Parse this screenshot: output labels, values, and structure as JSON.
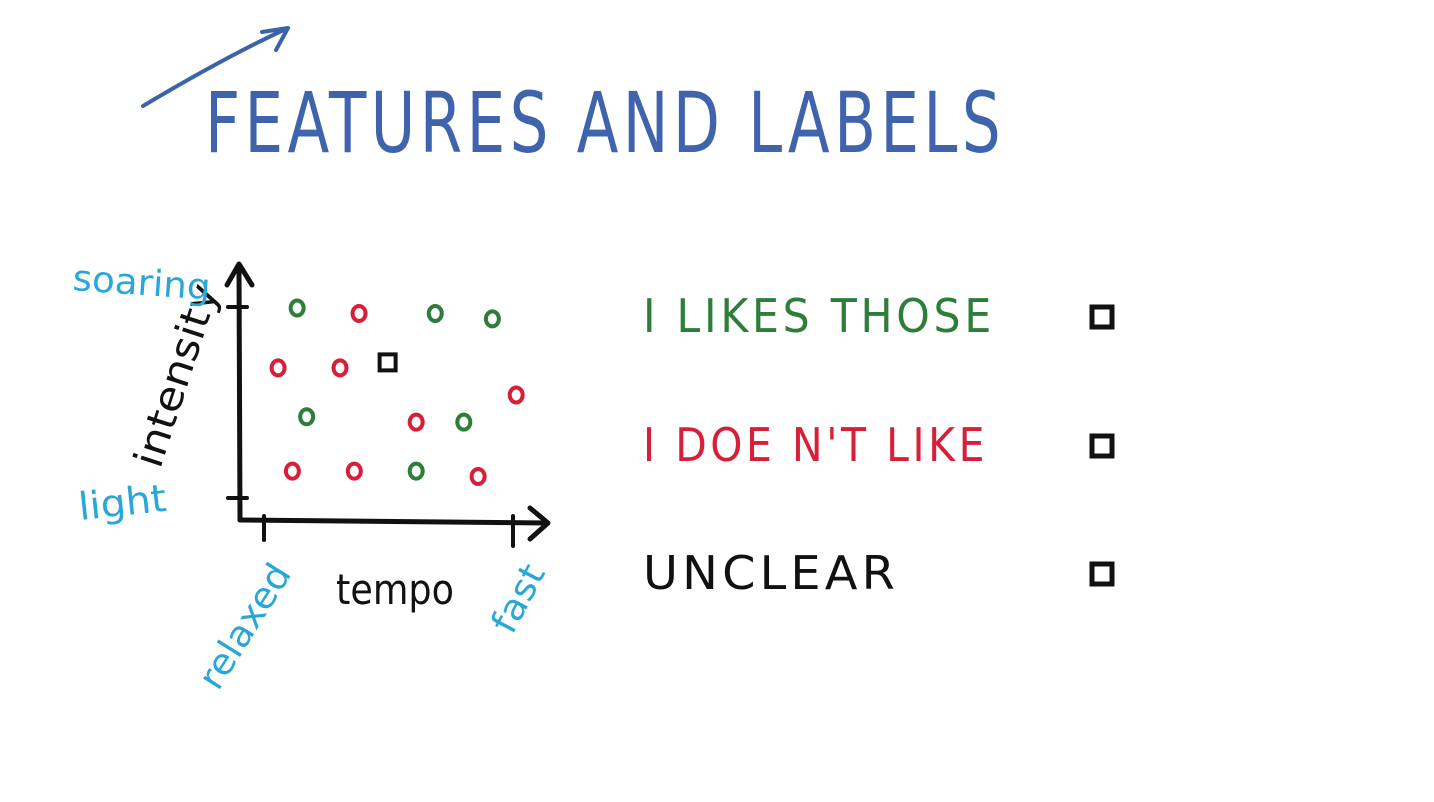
{
  "title": "FEATURES AND LABELS",
  "chart_data": {
    "type": "scatter",
    "xlabel": "tempo",
    "ylabel": "intensity",
    "x_tick_labels": [
      "relaxed",
      "fast"
    ],
    "y_tick_labels": [
      "light",
      "soaring"
    ],
    "legend": [
      {
        "label": "I LIKES THOSE",
        "color": "#2e7d3a",
        "marker": "circle"
      },
      {
        "label": "I DOE N'T LIKE",
        "color": "#d81f3a",
        "marker": "circle"
      },
      {
        "label": "UNCLEAR",
        "color": "#111111",
        "marker": "square"
      }
    ],
    "points": [
      {
        "x": 1.2,
        "y": 3.9,
        "label": "like"
      },
      {
        "x": 2.5,
        "y": 3.8,
        "label": "dislike"
      },
      {
        "x": 4.1,
        "y": 3.8,
        "label": "like"
      },
      {
        "x": 5.3,
        "y": 3.7,
        "label": "like"
      },
      {
        "x": 0.8,
        "y": 2.8,
        "label": "dislike"
      },
      {
        "x": 2.1,
        "y": 2.8,
        "label": "dislike"
      },
      {
        "x": 3.1,
        "y": 2.9,
        "label": "unclear"
      },
      {
        "x": 5.8,
        "y": 2.3,
        "label": "dislike"
      },
      {
        "x": 1.4,
        "y": 1.9,
        "label": "like"
      },
      {
        "x": 3.7,
        "y": 1.8,
        "label": "dislike"
      },
      {
        "x": 4.7,
        "y": 1.8,
        "label": "like"
      },
      {
        "x": 1.1,
        "y": 0.9,
        "label": "dislike"
      },
      {
        "x": 2.4,
        "y": 0.9,
        "label": "dislike"
      },
      {
        "x": 3.7,
        "y": 0.9,
        "label": "like"
      },
      {
        "x": 5.0,
        "y": 0.8,
        "label": "dislike"
      }
    ],
    "xlim": [
      0,
      6.3
    ],
    "ylim": [
      0,
      4.6
    ],
    "grid": false
  }
}
